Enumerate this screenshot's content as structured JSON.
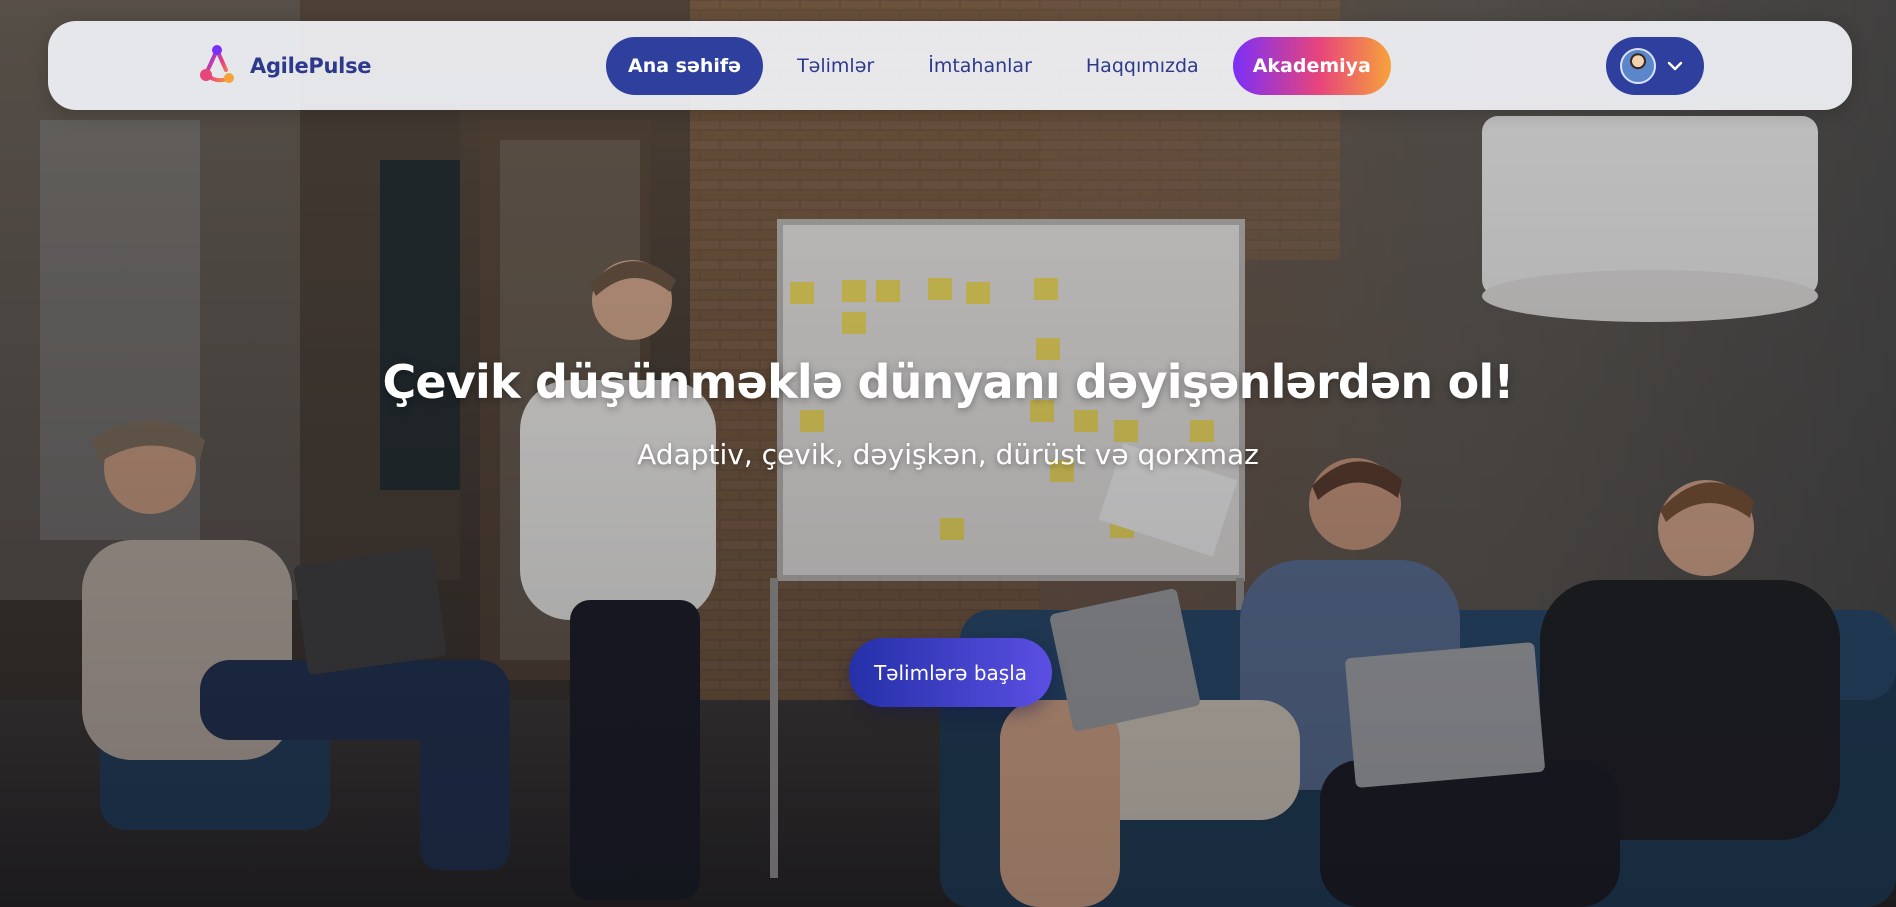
{
  "brand": {
    "name": "AgilePulse",
    "logo_colors": [
      "#7b2ff7",
      "#e8457a",
      "#f6a23b"
    ]
  },
  "nav": {
    "items": [
      {
        "label": "Ana səhifə",
        "active": true
      },
      {
        "label": "Təlimlər",
        "active": false
      },
      {
        "label": "İmtahanlar",
        "active": false
      },
      {
        "label": "Haqqımızda",
        "active": false
      },
      {
        "label": "Akademiya",
        "active": false,
        "style": "gradient"
      }
    ]
  },
  "user_menu": {
    "avatar_icon": "avatar",
    "dropdown_icon": "chevron-down-icon"
  },
  "hero": {
    "title": "Çevik düşünməklə dünyanı dəyişənlərdən ol!",
    "subtitle": "Adaptiv, çevik, dəyişkən, dürüst və qorxmaz",
    "cta_label": "Təlimlərə başla",
    "background_icon": "office-team-photo"
  },
  "colors": {
    "primary": "#2f3f9e",
    "text_primary": "#2d3a8c",
    "cta_gradient_start": "#2430a8",
    "cta_gradient_end": "#5b4fe3",
    "navbar_bg": "#f3f4f8"
  }
}
